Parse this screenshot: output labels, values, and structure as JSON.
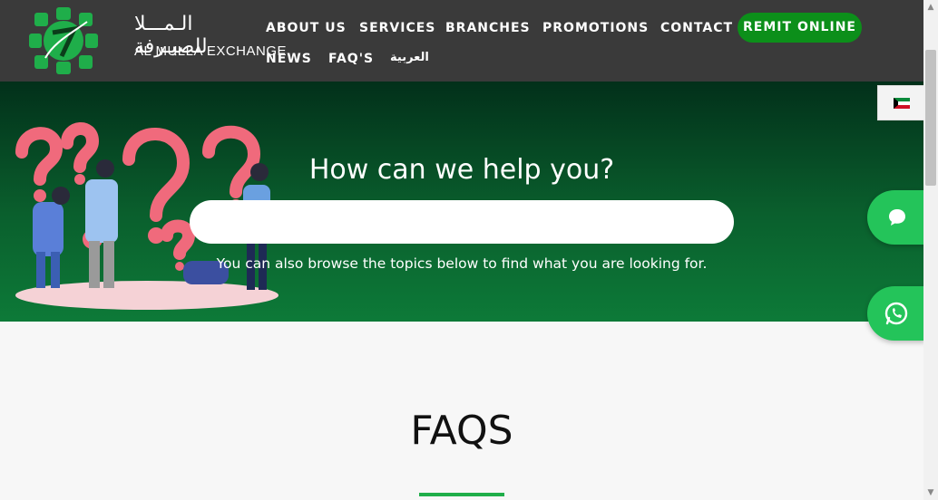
{
  "header": {
    "logo_ar": "الـمـــلا للصيـرفة",
    "logo_en": "AL MULLA EXCHANGE",
    "nav": {
      "about": "ABOUT US",
      "services": "SERVICES",
      "branches": "BRANCHES",
      "promotions": "PROMOTIONS",
      "contact": "CONTACT",
      "remit": "REMIT ONLINE",
      "news": "NEWS",
      "faqs": "FAQ'S",
      "arabic": "العربية"
    }
  },
  "hero": {
    "title": "How can we help you?",
    "search_value": "",
    "subtitle": "You can also browse the topics below to find what you are looking for."
  },
  "faqs": {
    "title": "FAQS"
  },
  "colors": {
    "header_bg": "#3a3a3a",
    "brand_green": "#0c8f1a",
    "floating_green": "#24c45a",
    "accent_line": "#1fae4a"
  },
  "icons": [
    "kuwait-flag-icon",
    "chat-bubble-icon",
    "whatsapp-icon"
  ]
}
